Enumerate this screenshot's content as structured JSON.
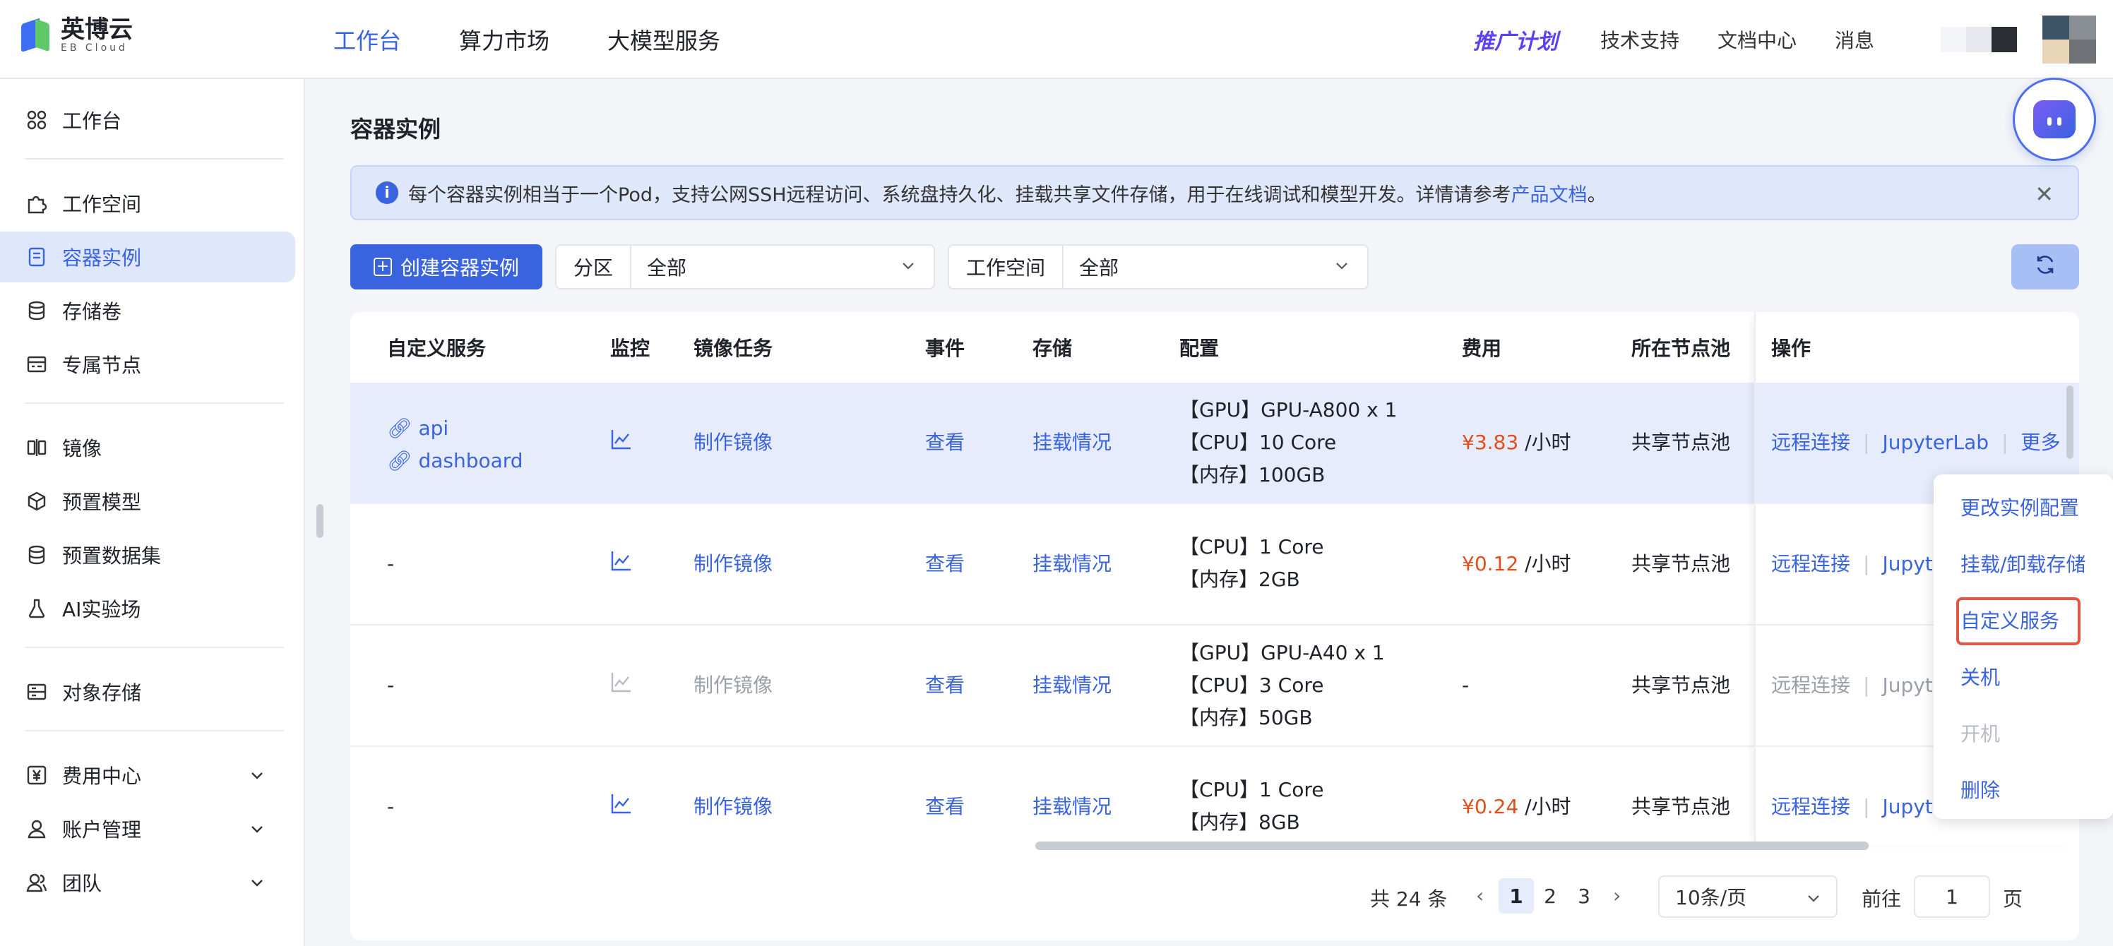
{
  "brand": {
    "name_cn": "英博云",
    "name_en": "EB Cloud"
  },
  "topnav": [
    {
      "label": "工作台",
      "active": true
    },
    {
      "label": "算力市场",
      "active": false
    },
    {
      "label": "大模型服务",
      "active": false
    }
  ],
  "topright": {
    "promo": "推广计划",
    "links": [
      "技术支持",
      "文档中心",
      "消息"
    ]
  },
  "sidebar": {
    "items": [
      {
        "label": "工作台",
        "icon": "grid-icon"
      },
      {
        "label": "工作空间",
        "icon": "puzzle-icon"
      },
      {
        "label": "容器实例",
        "icon": "container-icon",
        "active": true
      },
      {
        "label": "存储卷",
        "icon": "database-icon"
      },
      {
        "label": "专属节点",
        "icon": "server-icon"
      },
      {
        "label": "镜像",
        "icon": "mirror-icon"
      },
      {
        "label": "预置模型",
        "icon": "cube-icon"
      },
      {
        "label": "预置数据集",
        "icon": "database-icon"
      },
      {
        "label": "AI实验场",
        "icon": "flask-icon"
      },
      {
        "label": "对象存储",
        "icon": "storage-icon"
      },
      {
        "label": "费用中心",
        "icon": "yen-icon"
      },
      {
        "label": "账户管理",
        "icon": "user-icon"
      },
      {
        "label": "团队",
        "icon": "team-icon"
      }
    ]
  },
  "page": {
    "title": "容器实例"
  },
  "notice": {
    "text": "每个容器实例相当于一个Pod，支持公网SSH远程访问、系统盘持久化、挂载共享文件存储，用于在线调试和模型开发。详情请参考 ",
    "link": "产品文档",
    "suffix": "。"
  },
  "toolbar": {
    "create_label": "创建容器实例",
    "filter_zone": {
      "label": "分区",
      "value": "全部"
    },
    "filter_workspace": {
      "label": "工作空间",
      "value": "全部"
    }
  },
  "table": {
    "headers": [
      "自定义服务",
      "监控",
      "镜像任务",
      "事件",
      "存储",
      "配置",
      "费用",
      "所在节点池",
      "操作"
    ],
    "rows": [
      {
        "services": [
          "api",
          "dashboard"
        ],
        "image_task": "制作镜像",
        "event": "查看",
        "storage": "挂载情况",
        "config": [
          "【GPU】GPU-A800 x 1",
          "【CPU】10 Core",
          "【内存】100GB"
        ],
        "price": "¥3.83",
        "unit": " /小时",
        "pool": "共享节点池",
        "op1": "远程连接",
        "op2": "JupyterLab",
        "op3": "更多",
        "disabled": false
      },
      {
        "services_text": "-",
        "image_task": "制作镜像",
        "event": "查看",
        "storage": "挂载情况",
        "config": [
          "【CPU】1 Core",
          "【内存】2GB"
        ],
        "price": "¥0.12",
        "unit": " /小时",
        "pool": "共享节点池",
        "op1": "远程连接",
        "op2": "Jupyte",
        "disabled": false
      },
      {
        "services_text": "-",
        "image_task": "制作镜像",
        "event": "查看",
        "storage": "挂载情况",
        "config": [
          "【GPU】GPU-A40 x 1",
          "【CPU】3 Core",
          "【内存】50GB"
        ],
        "price_text": "-",
        "pool": "共享节点池",
        "op1": "远程连接",
        "op2": "Jupyte",
        "disabled": true
      },
      {
        "services_text": "-",
        "image_task": "制作镜像",
        "event": "查看",
        "storage": "挂载情况",
        "config": [
          "【CPU】1 Core",
          "【内存】8GB"
        ],
        "price": "¥0.24",
        "unit": " /小时",
        "pool": "共享节点池",
        "op1": "远程连接",
        "op2": "Jupyte",
        "disabled": false
      }
    ]
  },
  "dropdown": {
    "items": [
      {
        "label": "更改实例配置",
        "disabled": false
      },
      {
        "label": "挂载/卸载存储",
        "disabled": false
      },
      {
        "label": "自定义服务",
        "disabled": false,
        "highlighted": true
      },
      {
        "label": "关机",
        "disabled": false
      },
      {
        "label": "开机",
        "disabled": true
      },
      {
        "label": "删除",
        "disabled": false
      }
    ]
  },
  "pagination": {
    "total": "共 24 条",
    "pages": [
      "1",
      "2",
      "3"
    ],
    "current": "1",
    "page_size": "10条/页",
    "goto_label": "前往",
    "goto_value": "1",
    "page_suffix": "页"
  },
  "colors": {
    "primary": "#3a63e0",
    "price": "#e04f1a",
    "highlight_border": "#e0574a"
  }
}
